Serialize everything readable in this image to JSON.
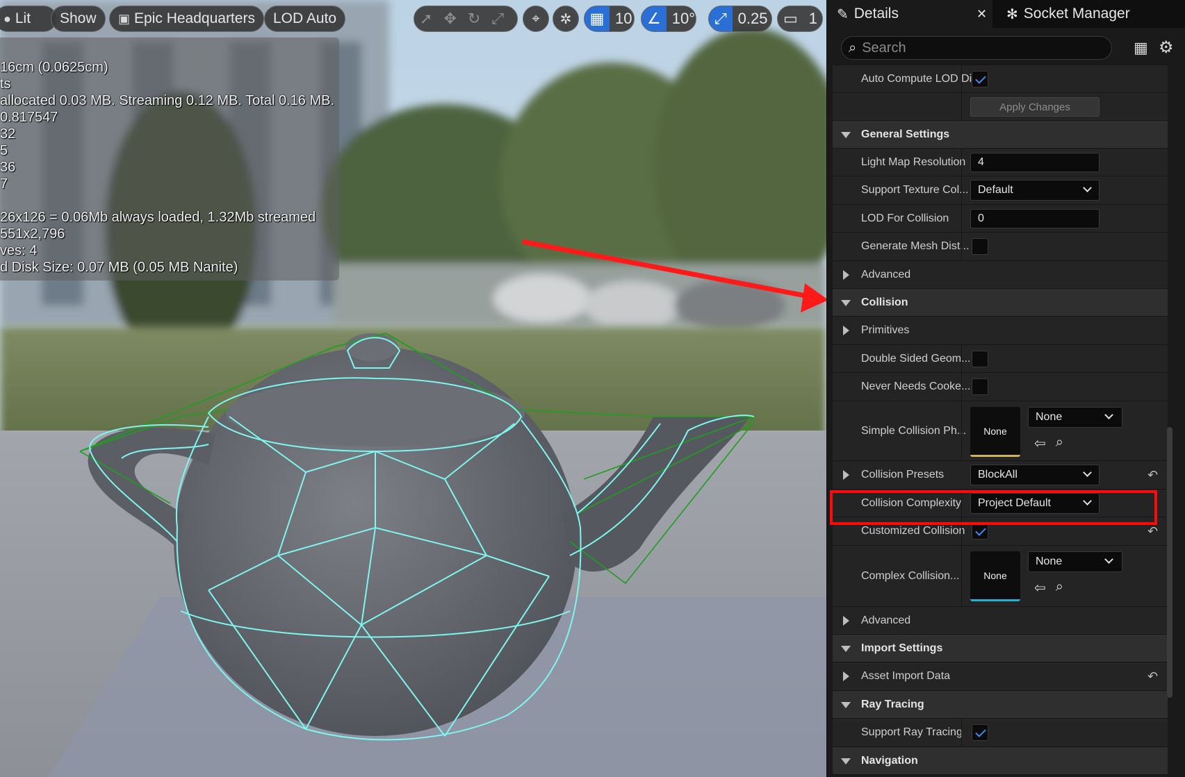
{
  "viewport": {
    "toolbar": {
      "lit_label": "Lit",
      "show_label": "Show",
      "preview_scene_label": "Epic Headquarters",
      "lod_label": "LOD Auto",
      "grid_value": "10",
      "angle_value": "10°",
      "scale_value": "0.25",
      "camera_speed_value": "1"
    },
    "stats_lines": [
      "16cm (0.0625cm)",
      "ts",
      "allocated 0.03 MB. Streaming 0.12 MB. Total 0.16 MB.",
      "0.817547",
      "32",
      "5",
      "36",
      "7",
      "",
      "26x126 = 0.06Mb always loaded, 1.32Mb streamed",
      "551x2,796",
      "ves:  4",
      "d Disk Size: 0.07 MB (0.05 MB Nanite)"
    ]
  },
  "panel": {
    "tabs": {
      "details": "Details",
      "socket_manager": "Socket Manager"
    },
    "search_placeholder": "Search",
    "auto_compute_lod": "Auto Compute LOD Di",
    "apply_changes": "Apply Changes",
    "general_settings": {
      "header": "General Settings",
      "light_map_resolution_label": "Light Map Resolution",
      "light_map_resolution_value": "4",
      "support_texture_label": "Support Texture Col...",
      "support_texture_value": "Default",
      "lod_for_collision_label": "LOD For Collision",
      "lod_for_collision_value": "0",
      "generate_mesh_label": "Generate Mesh Dist..."
    },
    "advanced_label": "Advanced",
    "collision": {
      "header": "Collision",
      "primitives": "Primitives",
      "double_sided_label": "Double Sided Geom...",
      "never_needs_label": "Never Needs Cooke...",
      "simple_collision_label": "Simple Collision Ph...",
      "simple_collision_thumb": "None",
      "simple_collision_combo": "None",
      "presets_label": "Collision Presets",
      "presets_value": "BlockAll",
      "complexity_label": "Collision Complexity",
      "complexity_value": "Project Default",
      "customized_label": "Customized Collision",
      "complex_collision_label": "Complex Collision...",
      "complex_collision_thumb": "None",
      "complex_collision_combo": "None",
      "advanced_label": "Advanced"
    },
    "import_settings": {
      "header": "Import Settings",
      "asset_import_data": "Asset Import Data"
    },
    "ray_tracing": {
      "header": "Ray Tracing",
      "support_label": "Support Ray Tracing"
    },
    "navigation": {
      "header": "Navigation"
    }
  },
  "colors": {
    "accent_blue": "#2a6fd6",
    "annotation_red": "#ff0a0a",
    "wireframe_cyan": "#7ff5f0",
    "wireframe_green": "#1f9e1f"
  }
}
